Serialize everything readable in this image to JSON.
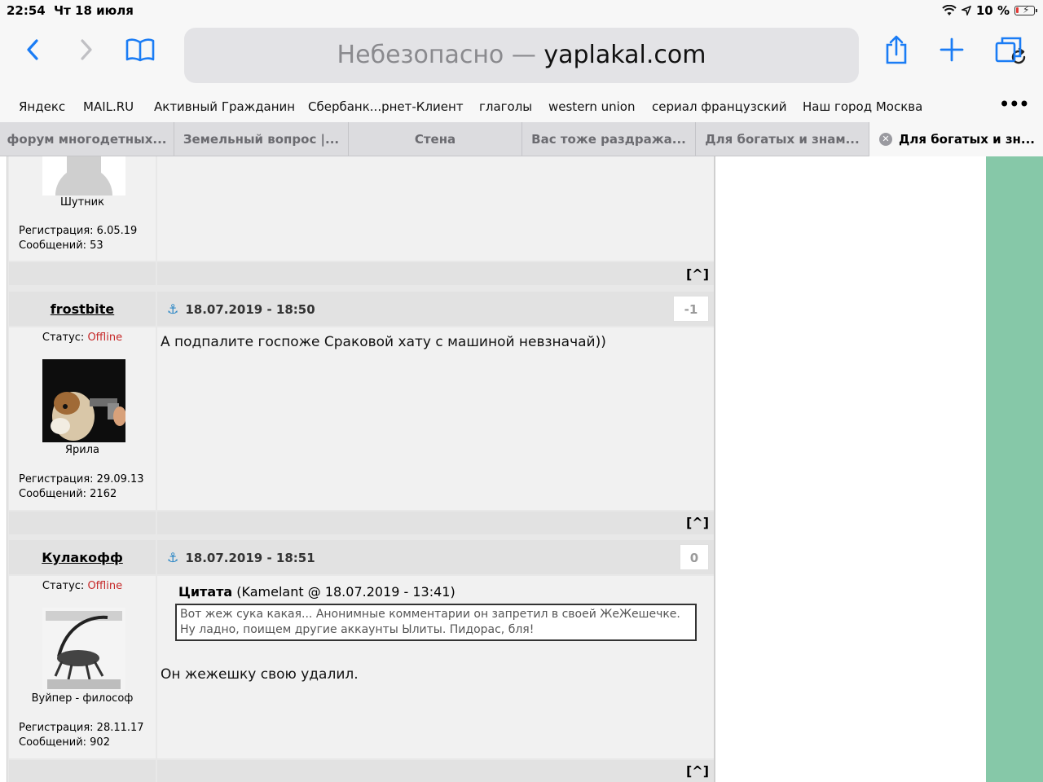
{
  "status_bar": {
    "time": "22:54",
    "date": "Чт 18 июля",
    "battery": "10 %"
  },
  "toolbar": {
    "address_insecure": "Небезопасно —",
    "address_domain": "yaplakal.com"
  },
  "bookmarks": [
    "Яндекс",
    "MAIL.RU",
    "Активный Гражданин",
    "Сбербанк...рнет-Клиент",
    "глаголы",
    "western union",
    "сериал французский",
    "Наш город Москва"
  ],
  "tabs": [
    "форум многодетных...",
    "Земельный вопрос |...",
    "Стена",
    "Вас тоже раздража...",
    "Для богатых и знам...",
    "Для богатых и зн..."
  ],
  "forum": {
    "prev_post": {
      "user_caption": "Шутник",
      "registration": "Регистрация: 6.05.19",
      "messages": "Сообщений: 53"
    },
    "to_top_label": "[^]",
    "status_label": "Статус:",
    "offline_label": "Offline",
    "posts": [
      {
        "username": "frostbite",
        "date": "18.07.2019 - 18:50",
        "rating": "-1",
        "text": "А подпалите госпоже Сраковой хату с машиной невзначай))",
        "user_caption": "Ярила",
        "registration": "Регистрация: 29.09.13",
        "messages": "Сообщений: 2162"
      },
      {
        "username": "Кулакофф",
        "date": "18.07.2019 - 18:51",
        "rating": "0",
        "quote_label": "Цитата",
        "quote_meta": "(Kamelant @ 18.07.2019 - 13:41)",
        "quote_text": "Вот жеж сука какая... Анонимные комментарии он запретил в своей ЖеЖешечке. Ну ладно, поищем другие аккаунты Ылиты. Пидорас, бля!",
        "text": "Он жежешку свою удалил.",
        "user_caption": "Вуйпер - философ",
        "registration": "Регистрация: 28.11.17",
        "messages": "Сообщений: 902"
      }
    ]
  }
}
